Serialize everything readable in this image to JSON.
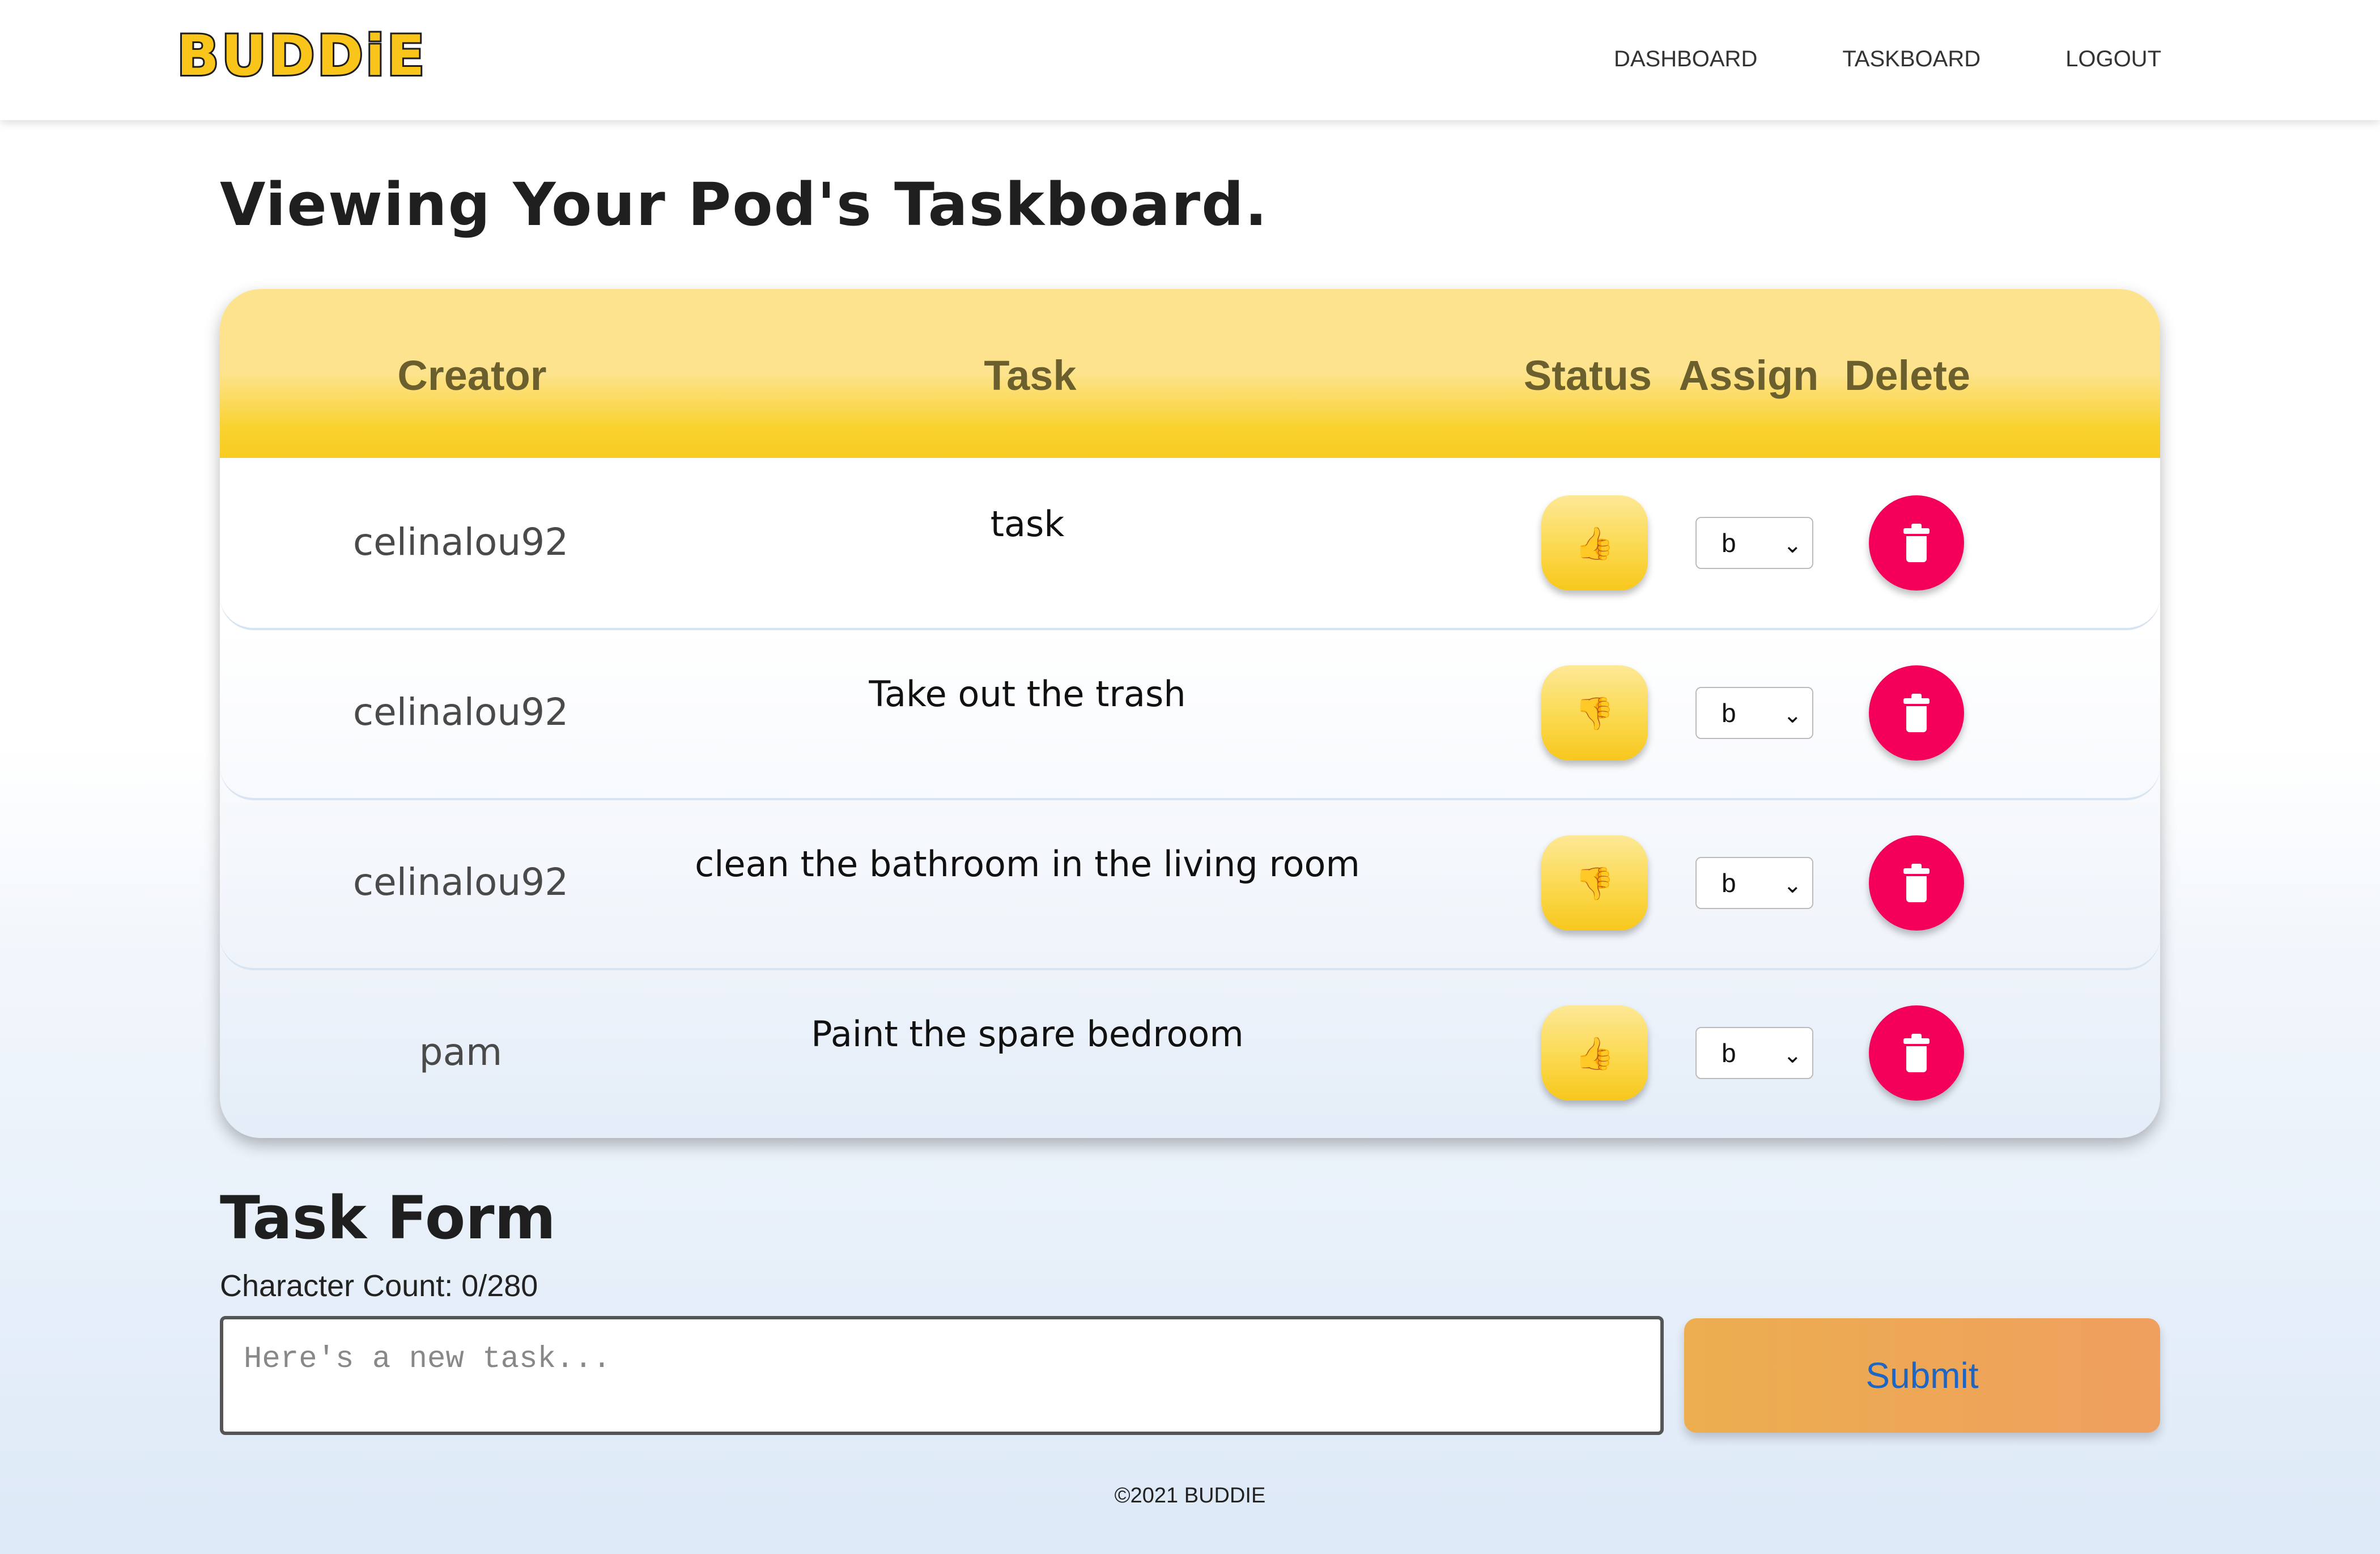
{
  "nav": {
    "logo": "BUDDiE",
    "links": [
      "DASHBOARD",
      "TASKBOARD",
      "LOGOUT"
    ]
  },
  "page": {
    "title": "Viewing Your Pod's Taskboard."
  },
  "table": {
    "headers": {
      "creator": "Creator",
      "task": "Task",
      "status": "Status",
      "assign": "Assign",
      "delete": "Delete"
    },
    "rows": [
      {
        "creator": "celinalou92",
        "task": "task",
        "status_icon": "👍",
        "assign": "b"
      },
      {
        "creator": "celinalou92",
        "task": "Take out the trash",
        "status_icon": "👎",
        "assign": "b"
      },
      {
        "creator": "celinalou92",
        "task": "clean the bathroom in the living room",
        "status_icon": "👎",
        "assign": "b"
      },
      {
        "creator": "pam",
        "task": "Paint the spare bedroom",
        "status_icon": "👍",
        "assign": "b"
      }
    ]
  },
  "form": {
    "title": "Task Form",
    "char_count": "Character Count: 0/280",
    "placeholder": "Here's a new task...",
    "submit_label": "Submit"
  },
  "footer": {
    "text": "©2021 BUDDIE"
  },
  "colors": {
    "header_yellow": "#f8cc21",
    "delete_red": "#f4005a",
    "submit_orange": "#ecae4f",
    "submit_text": "#1f66c2"
  }
}
